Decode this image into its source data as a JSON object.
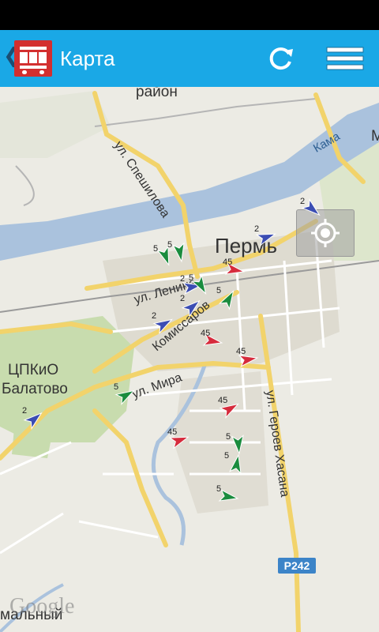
{
  "actionbar": {
    "title": "Карта",
    "back_glyph": "❮",
    "app_icon": "bus-icon",
    "refresh_icon": "refresh-icon",
    "menu_icon": "menu-icon"
  },
  "map": {
    "labels": {
      "district": "район",
      "city": "Пермь",
      "ctpkio": "ЦПКиО",
      "balatovo": "Балатово",
      "bottom_left": "мальный",
      "edge_m": "М"
    },
    "streets": {
      "speshilova": "ул. Спешилова",
      "lenina": "ул. Ленина",
      "komissarov": "Комиссаров",
      "mira": "ул. Мира",
      "geroev_hasana": "ул. Героев Хасана",
      "kama": "Кама"
    },
    "route_badge": "P242",
    "google": "Google",
    "locate_icon": "my-location-icon",
    "vehicles": [
      {
        "num": "2",
        "color": "#3b4db3"
      },
      {
        "num": "2",
        "color": "#3b4db3"
      },
      {
        "num": "5",
        "color": "#1a8c3e"
      },
      {
        "num": "5",
        "color": "#1a8c3e"
      },
      {
        "num": "45",
        "color": "#d62b3c"
      },
      {
        "num": "2",
        "color": "#3b4db3"
      },
      {
        "num": "5",
        "color": "#1a8c3e"
      },
      {
        "num": "5",
        "color": "#1a8c3e"
      },
      {
        "num": "2",
        "color": "#3b4db3"
      },
      {
        "num": "2",
        "color": "#3b4db3"
      },
      {
        "num": "45",
        "color": "#d62b3c"
      },
      {
        "num": "45",
        "color": "#d62b3c"
      },
      {
        "num": "5",
        "color": "#1a8c3e"
      },
      {
        "num": "2",
        "color": "#3b4db3"
      },
      {
        "num": "45",
        "color": "#d62b3c"
      },
      {
        "num": "45",
        "color": "#d62b3c"
      },
      {
        "num": "5",
        "color": "#1a8c3e"
      },
      {
        "num": "5",
        "color": "#1a8c3e"
      },
      {
        "num": "5",
        "color": "#1a8c3e"
      }
    ]
  }
}
